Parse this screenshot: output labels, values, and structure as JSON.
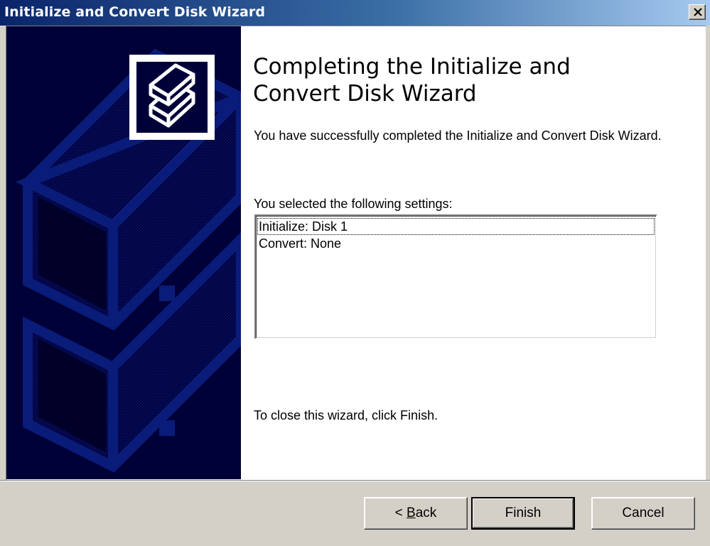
{
  "window": {
    "title": "Initialize and Convert Disk Wizard",
    "close_icon": "close-icon"
  },
  "content": {
    "heading": "Completing the Initialize and Convert Disk Wizard",
    "description": "You have successfully completed the Initialize and Convert Disk Wizard.",
    "settings_label": "You selected the following settings:",
    "settings": [
      "Initialize: Disk 1",
      "Convert: None"
    ],
    "close_message": "To close this wizard, click Finish."
  },
  "buttons": {
    "back_prefix": "< ",
    "back_mnemonic": "B",
    "back_rest": "ack",
    "finish": "Finish",
    "cancel": "Cancel"
  },
  "colors": {
    "titlebar_start": "#0a246a",
    "banner": "#000038",
    "disk_outline": "#0a1c7a",
    "dialog_face": "#d4d0c8"
  }
}
